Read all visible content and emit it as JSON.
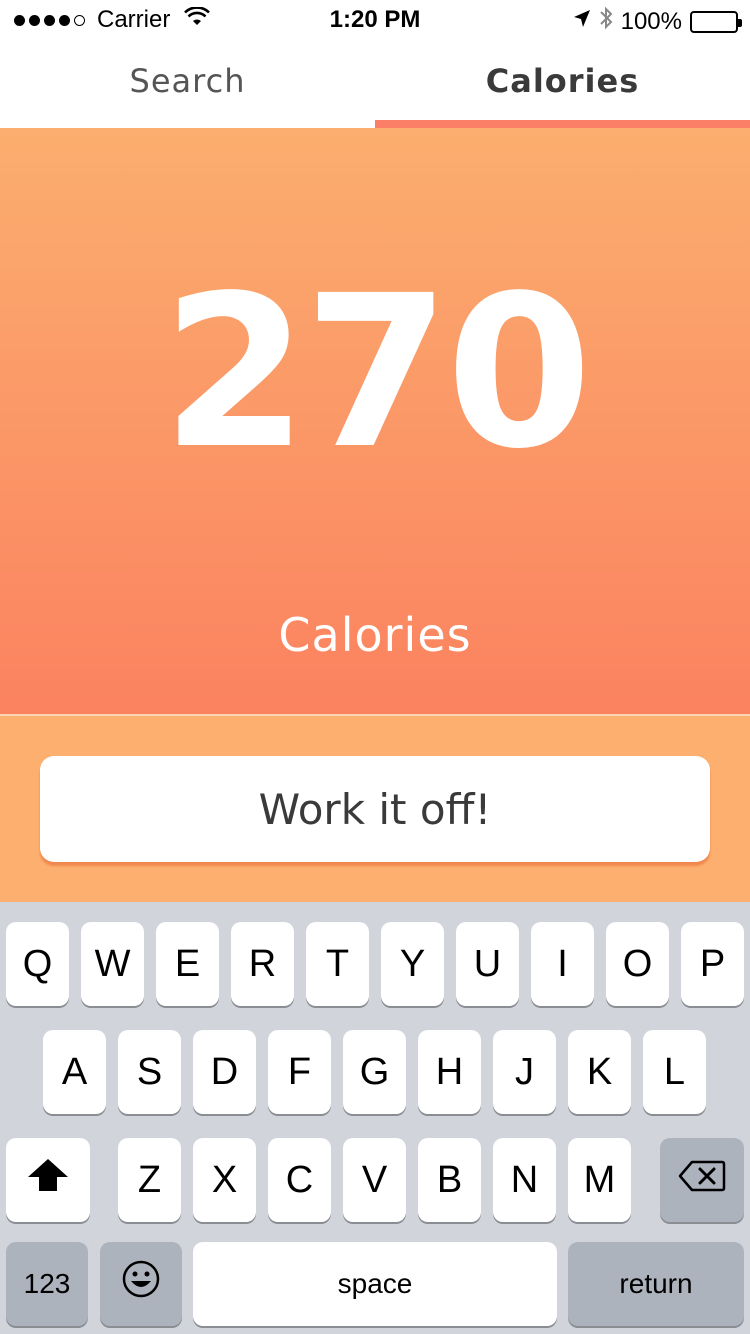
{
  "status_bar": {
    "carrier": "Carrier",
    "time": "1:20 PM",
    "battery": "100%"
  },
  "tabs": [
    {
      "label": "Search",
      "active": false
    },
    {
      "label": "Calories",
      "active": true
    }
  ],
  "hero": {
    "value": "270",
    "label": "Calories"
  },
  "action": {
    "button_label": "Work it off!"
  },
  "keyboard": {
    "row1": [
      "Q",
      "W",
      "E",
      "R",
      "T",
      "Y",
      "U",
      "I",
      "O",
      "P"
    ],
    "row2": [
      "A",
      "S",
      "D",
      "F",
      "G",
      "H",
      "J",
      "K",
      "L"
    ],
    "row3": [
      "Z",
      "X",
      "C",
      "V",
      "B",
      "N",
      "M"
    ],
    "numbers_key": "123",
    "space_key": "space",
    "return_key": "return"
  },
  "colors": {
    "accent": "#fb7e67",
    "hero_top": "#fbae6f",
    "hero_bottom": "#fb825f",
    "band": "#fcaf6e"
  },
  "icons": [
    "wifi-icon",
    "location-arrow-icon",
    "bluetooth-icon",
    "battery-icon",
    "shift-icon",
    "emoji-icon",
    "backspace-icon"
  ]
}
